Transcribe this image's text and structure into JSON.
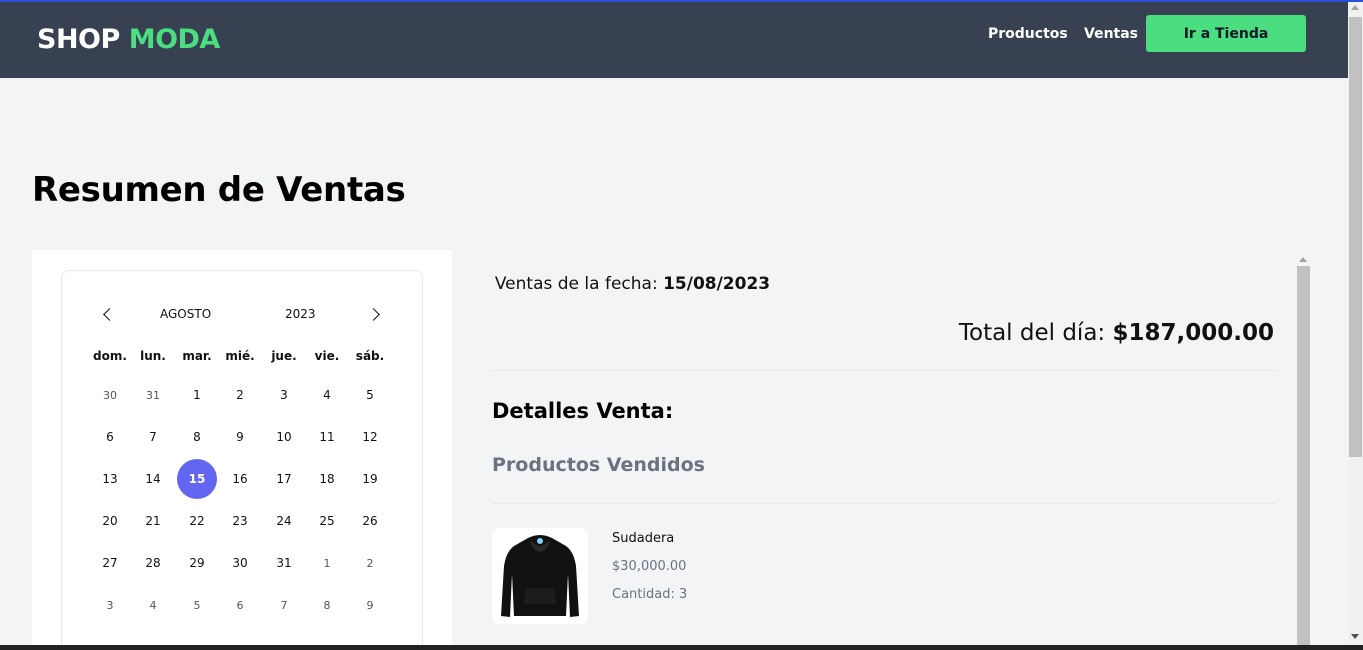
{
  "header": {
    "logo_part1": "SHOP",
    "logo_part2": "MODA",
    "nav_productos": "Productos",
    "nav_ventas": "Ventas",
    "store_button": "Ir a Tienda",
    "accent_color": "#4ade80",
    "bg_color": "#374151"
  },
  "page": {
    "title": "Resumen de Ventas"
  },
  "calendar": {
    "month": "AGOSTO",
    "year": "2023",
    "prev_icon": "chevron-left-icon",
    "next_icon": "chevron-right-icon",
    "weekdays": [
      "dom.",
      "lun.",
      "mar.",
      "mié.",
      "jue.",
      "vie.",
      "sáb."
    ],
    "weeks": [
      [
        "30",
        "31",
        "1",
        "2",
        "3",
        "4",
        "5"
      ],
      [
        "6",
        "7",
        "8",
        "9",
        "10",
        "11",
        "12"
      ],
      [
        "13",
        "14",
        "15",
        "16",
        "17",
        "18",
        "19"
      ],
      [
        "20",
        "21",
        "22",
        "23",
        "24",
        "25",
        "26"
      ],
      [
        "27",
        "28",
        "29",
        "30",
        "31",
        "1",
        "2"
      ],
      [
        "3",
        "4",
        "5",
        "6",
        "7",
        "8",
        "9"
      ]
    ],
    "selected_day": "15",
    "selected_color": "#6366f1"
  },
  "summary": {
    "date_label": "Ventas de la fecha:",
    "date_value": "15/08/2023",
    "total_label": "Total del día:",
    "total_value": "$187,000.00"
  },
  "details": {
    "title": "Detalles Venta:",
    "subtitle": "Productos Vendidos",
    "products": [
      {
        "name": "Sudadera",
        "price": "$30,000.00",
        "quantity": "Cantidad: 3",
        "image_icon": "hoodie-icon"
      }
    ]
  }
}
